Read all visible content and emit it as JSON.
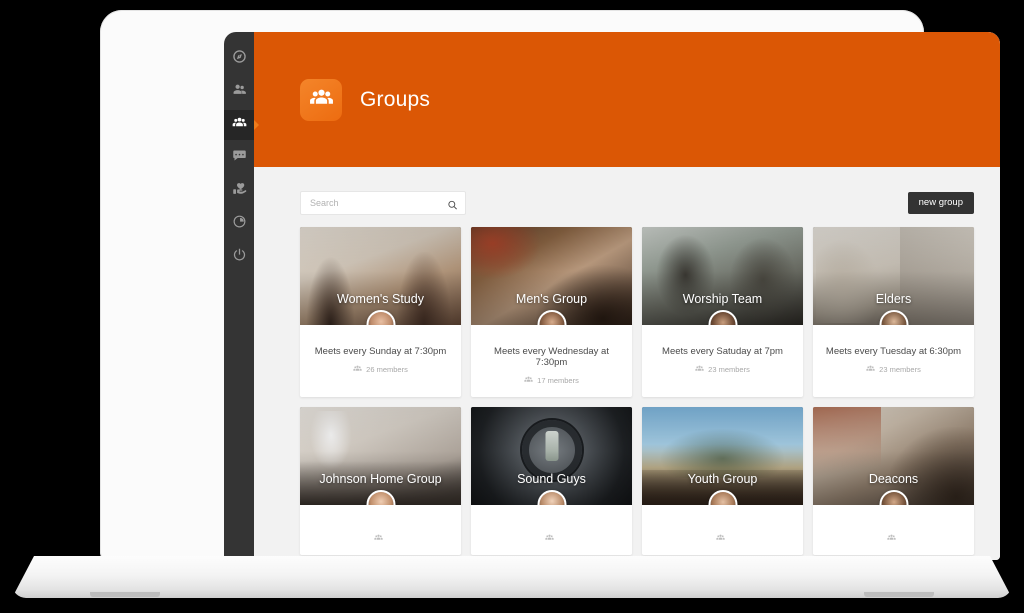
{
  "header": {
    "title": "Groups",
    "logo_icon": "group-people-icon",
    "bg_color": "#db5705",
    "logo_color": "#ef7c1b"
  },
  "sidebar": {
    "bg_color": "#343434",
    "active_index": 2,
    "items": [
      {
        "name": "dashboard",
        "icon": "compass-icon",
        "active": false
      },
      {
        "name": "people",
        "icon": "person-group-icon",
        "active": false
      },
      {
        "name": "groups",
        "icon": "groups-icon",
        "active": true
      },
      {
        "name": "messages",
        "icon": "chat-bubble-icon",
        "active": false
      },
      {
        "name": "giving",
        "icon": "hand-heart-icon",
        "active": false
      },
      {
        "name": "reports",
        "icon": "pie-chart-icon",
        "active": false
      },
      {
        "name": "logout",
        "icon": "power-icon",
        "active": false
      }
    ]
  },
  "toolbar": {
    "search_placeholder": "Search",
    "search_value": "",
    "search_icon": "magnifier-icon",
    "new_group_label": "new group",
    "new_group_color": "#333333"
  },
  "cards": [
    {
      "title": "Women's Study",
      "meets": "Meets every Sunday at 7:30pm",
      "members": "26 members",
      "photo_class": "ph-women",
      "avatar_class": "fa-w1"
    },
    {
      "title": "Men's Group",
      "meets": "Meets every Wednesday at 7:30pm",
      "members": "17 members",
      "photo_class": "ph-men",
      "avatar_class": "fa-m1"
    },
    {
      "title": "Worship Team",
      "meets": "Meets every Satuday at 7pm",
      "members": "23 members",
      "photo_class": "ph-worship",
      "avatar_class": "fa-m2"
    },
    {
      "title": "Elders",
      "meets": "Meets every Tuesday at 6:30pm",
      "members": "23 members",
      "photo_class": "ph-elders",
      "avatar_class": "fa-m3"
    },
    {
      "title": "Johnson Home Group",
      "meets": "",
      "members": "",
      "photo_class": "ph-johnson",
      "avatar_class": "fa-w2"
    },
    {
      "title": "Sound Guys",
      "meets": "",
      "members": "",
      "photo_class": "ph-sound",
      "avatar_class": "fa-w3"
    },
    {
      "title": "Youth Group",
      "meets": "",
      "members": "",
      "photo_class": "ph-youth",
      "avatar_class": "fa-w4"
    },
    {
      "title": "Deacons",
      "meets": "",
      "members": "",
      "photo_class": "ph-deacons",
      "avatar_class": "fa-m4"
    }
  ]
}
